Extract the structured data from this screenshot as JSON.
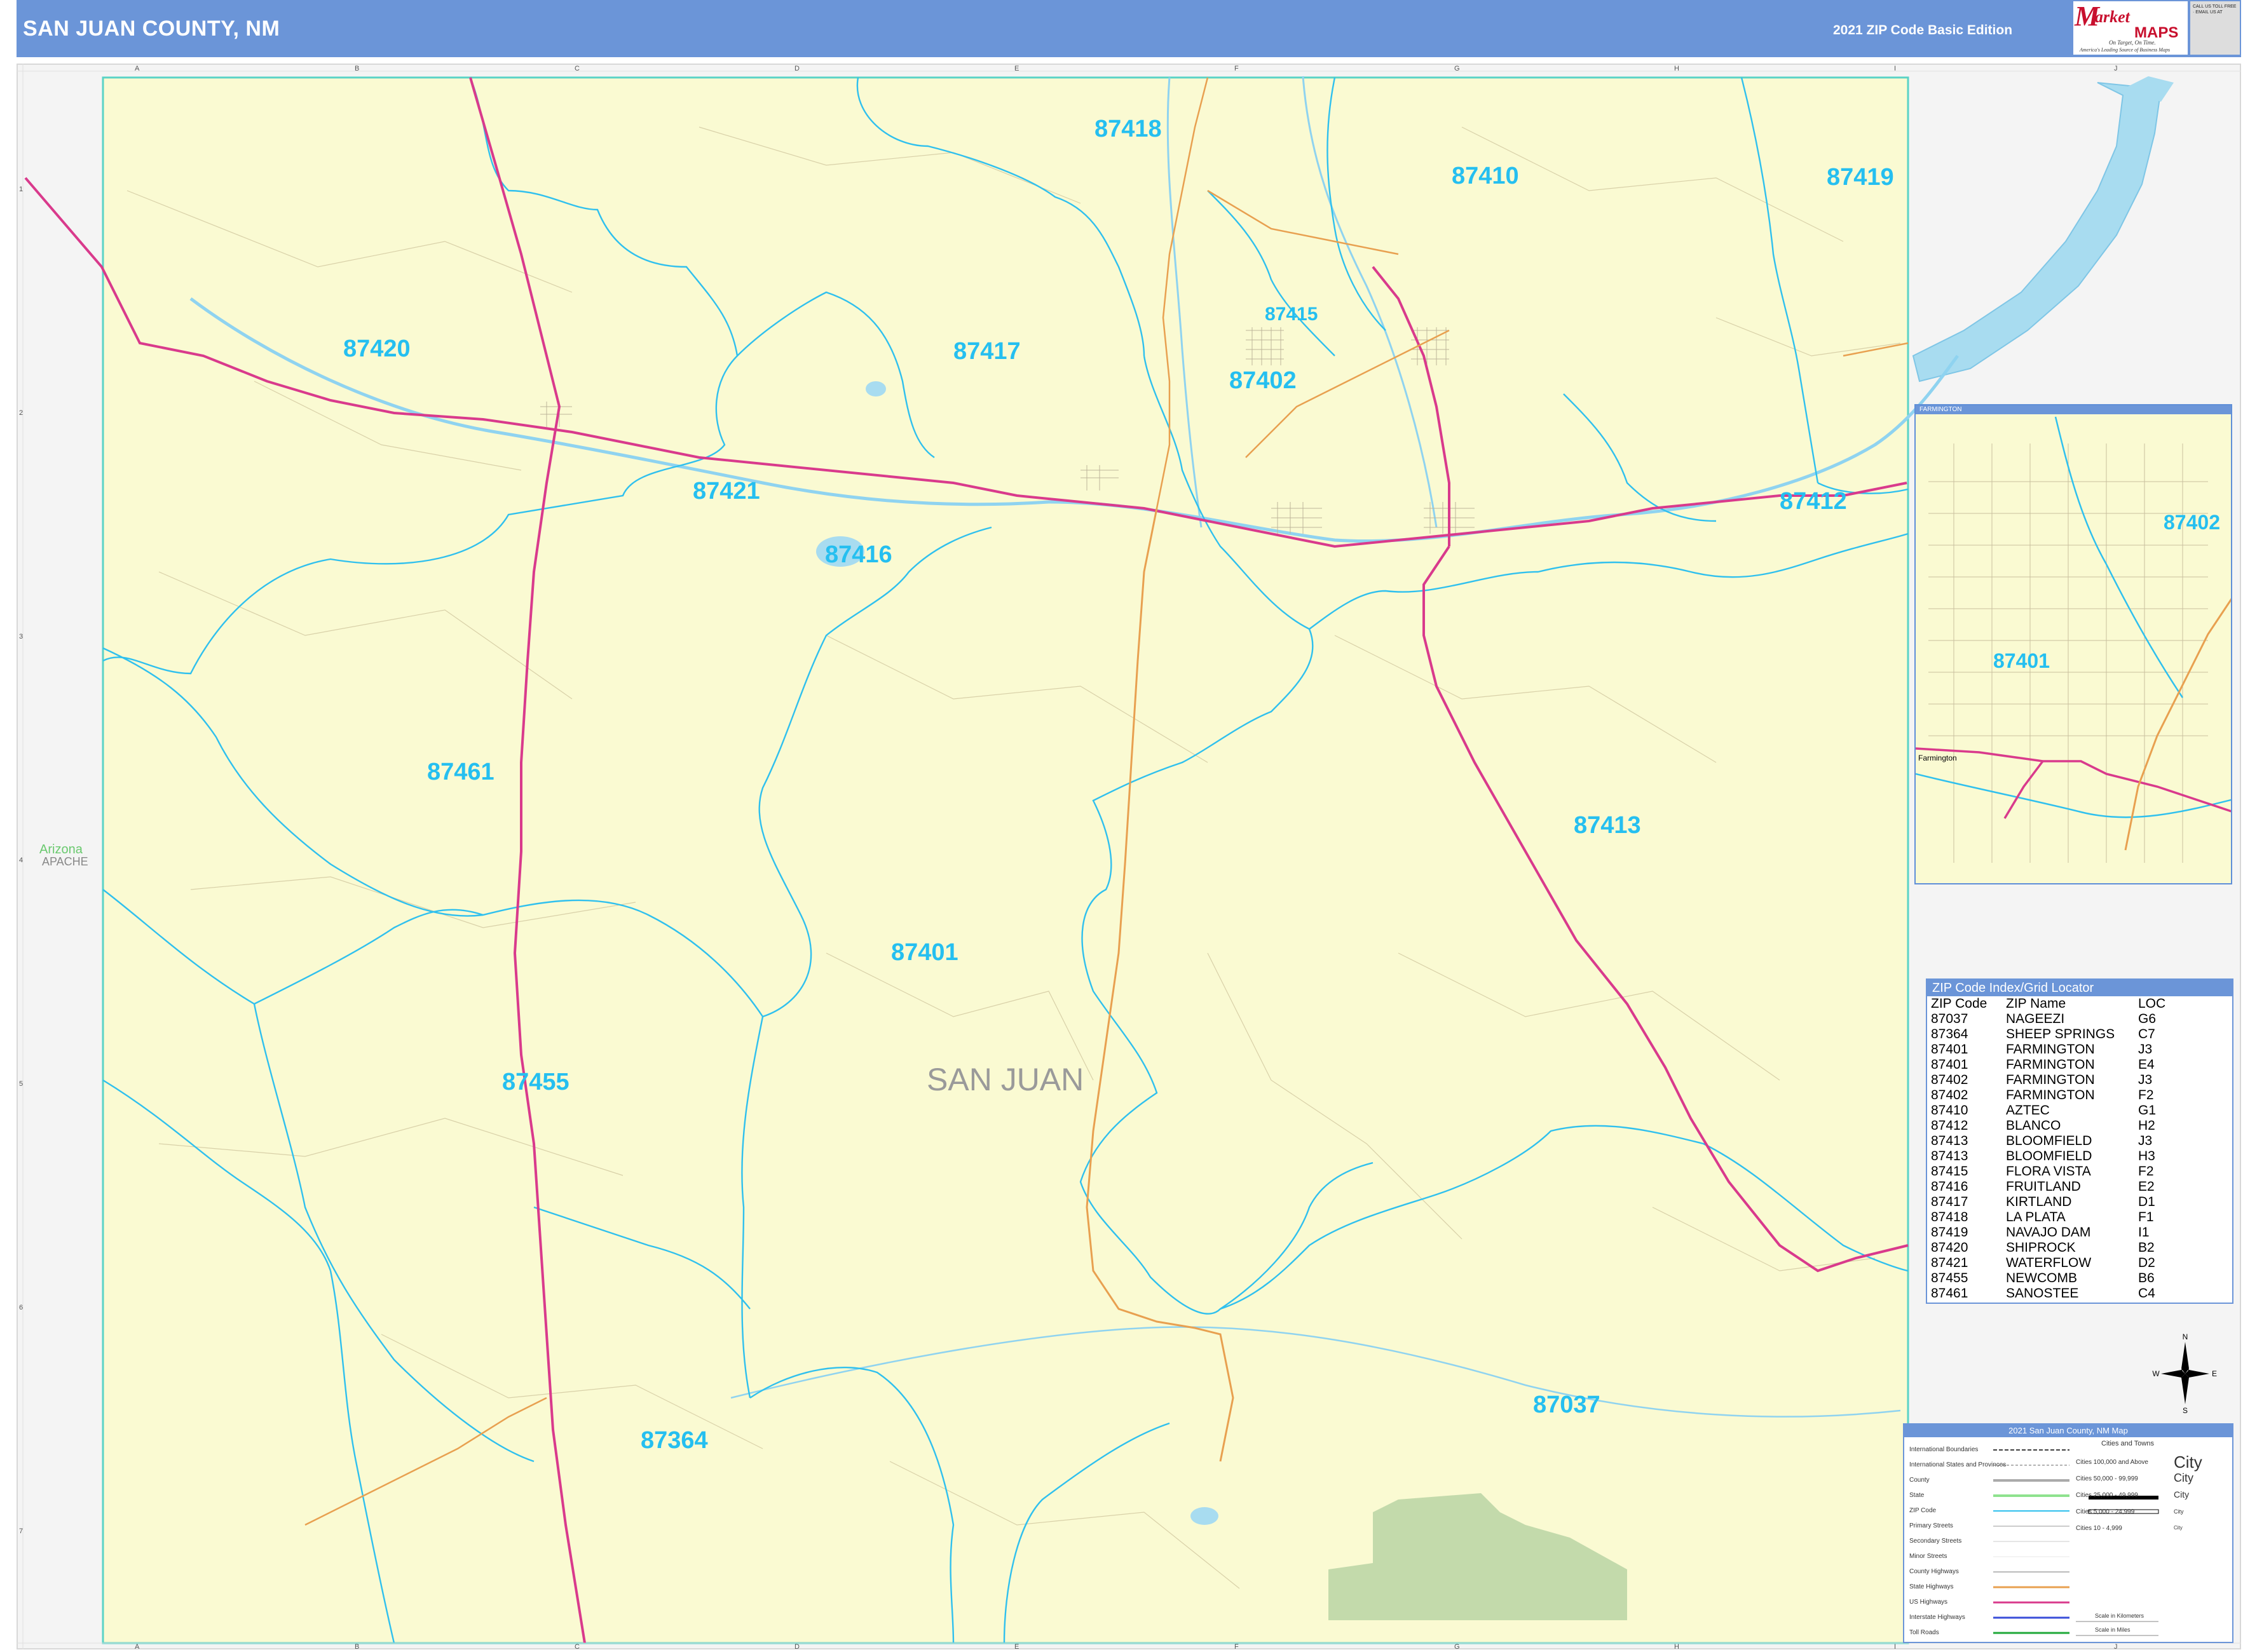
{
  "header": {
    "title": "SAN JUAN COUNTY, NM",
    "edition": "2021 ZIP Code Basic Edition",
    "logo_text": "Market MAPS",
    "logo_tagline": "On Target, On Time.",
    "logo_tagline2": "America's Leading Source of Business Maps",
    "contact": "CALL US TOLL FREE · EMAIL US AT"
  },
  "colors": {
    "header": "#6b95d8",
    "land": "#fafad2",
    "zip_boundary": "#2fc0ee",
    "us_highway": "#d93a8c",
    "state_highway": "#e8a050",
    "park": "#b9d4a4",
    "water": "#a8dcf0"
  },
  "grid": {
    "columns": [
      "A",
      "B",
      "C",
      "D",
      "E",
      "F",
      "G",
      "H",
      "I",
      "J"
    ],
    "rows": [
      "1",
      "2",
      "3",
      "4",
      "5",
      "6",
      "7"
    ]
  },
  "map": {
    "county_label": "SAN JUAN",
    "state_label": "Arizona",
    "county_west_label": "APACHE",
    "zip_labels": [
      "87418",
      "87410",
      "87419",
      "87420",
      "87417",
      "87415",
      "87402",
      "87421",
      "87412",
      "87416",
      "87461",
      "87413",
      "87401",
      "87455",
      "87037",
      "87364"
    ],
    "inset_title": "FARMINGTON",
    "inset_zips": [
      "87402",
      "87401"
    ],
    "inset_city": "Farmington"
  },
  "index": {
    "title": "ZIP Code Index/Grid Locator",
    "headers": [
      "ZIP Code",
      "ZIP Name",
      "LOC"
    ],
    "rows": [
      [
        "87037",
        "NAGEEZI",
        "G6"
      ],
      [
        "87364",
        "SHEEP SPRINGS",
        "C7"
      ],
      [
        "87401",
        "FARMINGTON",
        "J3"
      ],
      [
        "87401",
        "FARMINGTON",
        "E4"
      ],
      [
        "87402",
        "FARMINGTON",
        "J3"
      ],
      [
        "87402",
        "FARMINGTON",
        "F2"
      ],
      [
        "87410",
        "AZTEC",
        "G1"
      ],
      [
        "87412",
        "BLANCO",
        "H2"
      ],
      [
        "87413",
        "BLOOMFIELD",
        "J3"
      ],
      [
        "87413",
        "BLOOMFIELD",
        "H3"
      ],
      [
        "87415",
        "FLORA VISTA",
        "F2"
      ],
      [
        "87416",
        "FRUITLAND",
        "E2"
      ],
      [
        "87417",
        "KIRTLAND",
        "D1"
      ],
      [
        "87418",
        "LA PLATA",
        "F1"
      ],
      [
        "87419",
        "NAVAJO DAM",
        "I1"
      ],
      [
        "87420",
        "SHIPROCK",
        "B2"
      ],
      [
        "87421",
        "WATERFLOW",
        "D2"
      ],
      [
        "87455",
        "NEWCOMB",
        "B6"
      ],
      [
        "87461",
        "SANOSTEE",
        "C4"
      ]
    ]
  },
  "legend": {
    "title": "2021 San Juan County, NM Map",
    "items": [
      "International Boundaries",
      "International States and Provinces",
      "County",
      "State",
      "ZIP Code",
      "Primary Streets",
      "Secondary Streets",
      "Minor Streets",
      "County Highways",
      "State Highways",
      "US Highways",
      "Interstate Highways",
      "Toll Roads"
    ],
    "cities_header": "Cities and Towns",
    "cities": [
      {
        "range": "Cities 100,000 and Above",
        "sample": "City"
      },
      {
        "range": "Cities 50,000 - 99,999",
        "sample": "City"
      },
      {
        "range": "Cities 25,000 - 49,999",
        "sample": "City"
      },
      {
        "range": "Cities 5,000 - 24,999",
        "sample": "City"
      },
      {
        "range": "Cities 10 - 4,999",
        "sample": "City"
      }
    ],
    "scale_km": "Scale in Kilometers",
    "scale_mi": "Scale in Miles"
  },
  "compass": {
    "n": "N",
    "e": "E",
    "s": "S",
    "w": "W"
  }
}
